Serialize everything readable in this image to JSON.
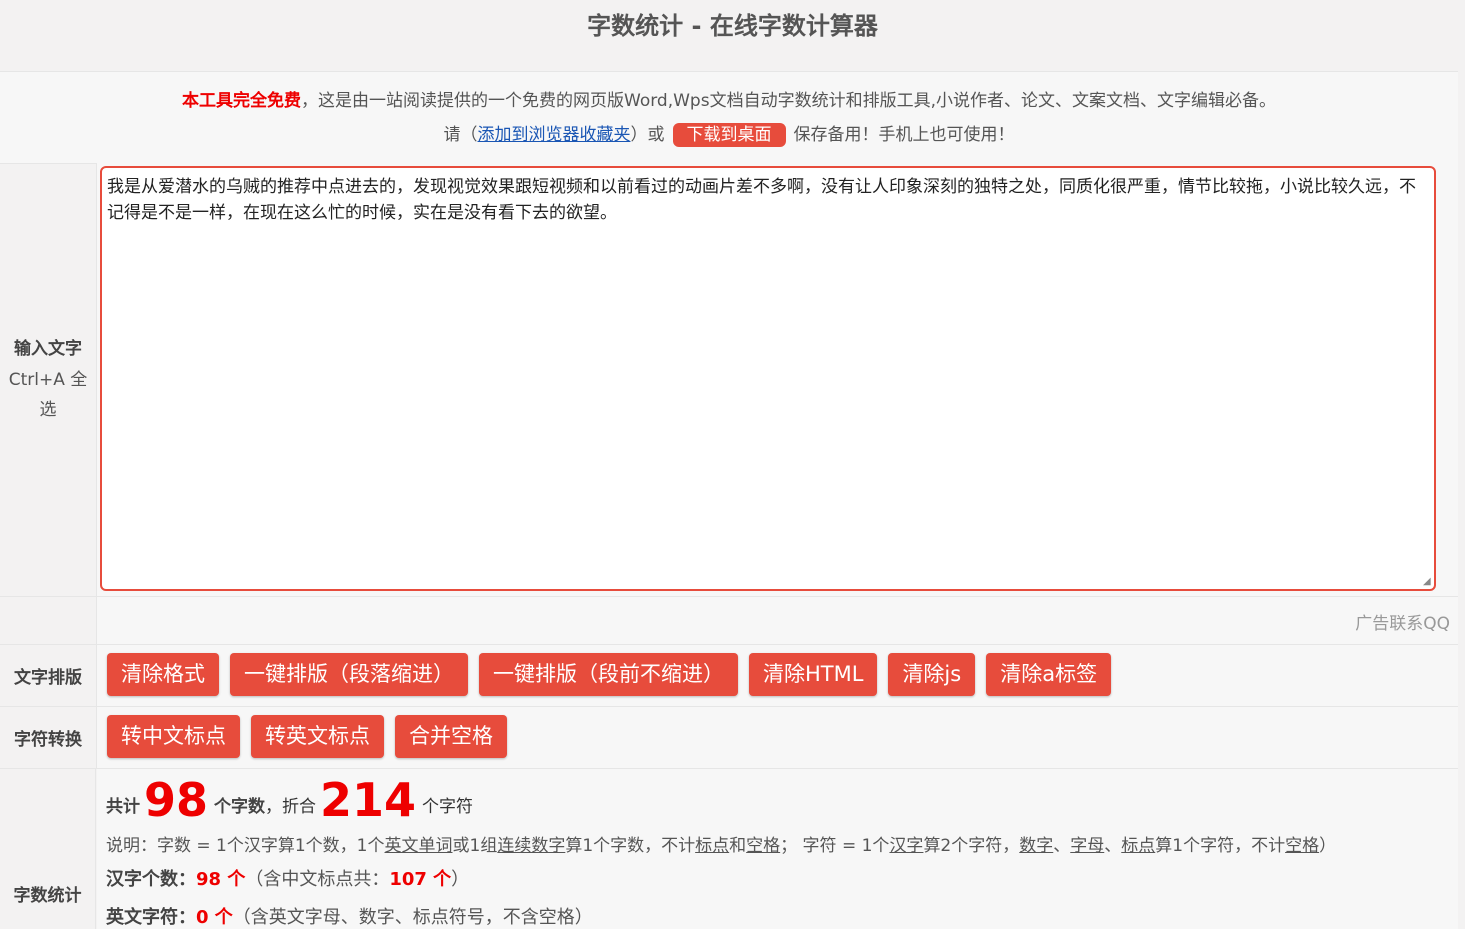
{
  "page_title": "字数统计 - 在线字数计算器",
  "notice": {
    "free_text": "本工具完全免费",
    "intro": "，这是由一站阅读提供的一个免费的网页版Word,Wps文档自动字数统计和排版工具,小说作者、论文、文案文档、文字编辑必备。",
    "please": "请（",
    "bookmark_link": "添加到浏览器收藏夹",
    "or": "）或",
    "download_button": "下载到桌面",
    "save_text": "保存备用！手机上也可使用！"
  },
  "input": {
    "label": "输入文字",
    "hint": "Ctrl+A 全选",
    "text": "我是从爱潜水的乌贼的推荐中点进去的，发现视觉效果跟短视频和以前看过的动画片差不多啊，没有让人印象深刻的独特之处，同质化很严重，情节比较拖，小说比较久远，不记得是不是一样，在现在这么忙的时候，实在是没有看下去的欲望。"
  },
  "ad_text": "广告联系QQ",
  "format": {
    "label": "文字排版",
    "buttons": [
      "清除格式",
      "一键排版（段落缩进）",
      "一键排版（段前不缩进）",
      "清除HTML",
      "清除js",
      "清除a标签"
    ]
  },
  "convert": {
    "label": "字符转换",
    "buttons": [
      "转中文标点",
      "转英文标点",
      "合并空格"
    ]
  },
  "stats": {
    "label": "字数统计",
    "total_prefix": "共计",
    "word_count": "98",
    "word_unit": "个字数",
    "sep": "，折合",
    "char_count": "214",
    "char_unit": "个字符",
    "desc_a": "说明：字数 = 1个汉字算1个数，1个",
    "desc_b": "英文单词",
    "desc_c": "或1组",
    "desc_d": "连续数字",
    "desc_e": "算1个字数，不计",
    "desc_f": "标点",
    "desc_g": "和",
    "desc_h": "空格",
    "desc_i": "；  字符 = 1个",
    "desc_j": "汉字",
    "desc_k": "算2个字符，",
    "desc_l": "数字",
    "desc_m": "、",
    "desc_n": "字母",
    "desc_o": "、",
    "desc_p": "标点",
    "desc_q": "算1个字符，不计",
    "desc_r": "空格",
    "desc_s": "）",
    "hanzi_label": "汉字个数：",
    "hanzi_count": "98 个",
    "hanzi_note_a": "（含中文标点共：",
    "hanzi_punct": "107 个",
    "hanzi_note_b": "）",
    "eng_label": "英文字符：",
    "eng_count": "0 个",
    "eng_note": "（含英文字母、数字、标点符号，不含空格）"
  }
}
